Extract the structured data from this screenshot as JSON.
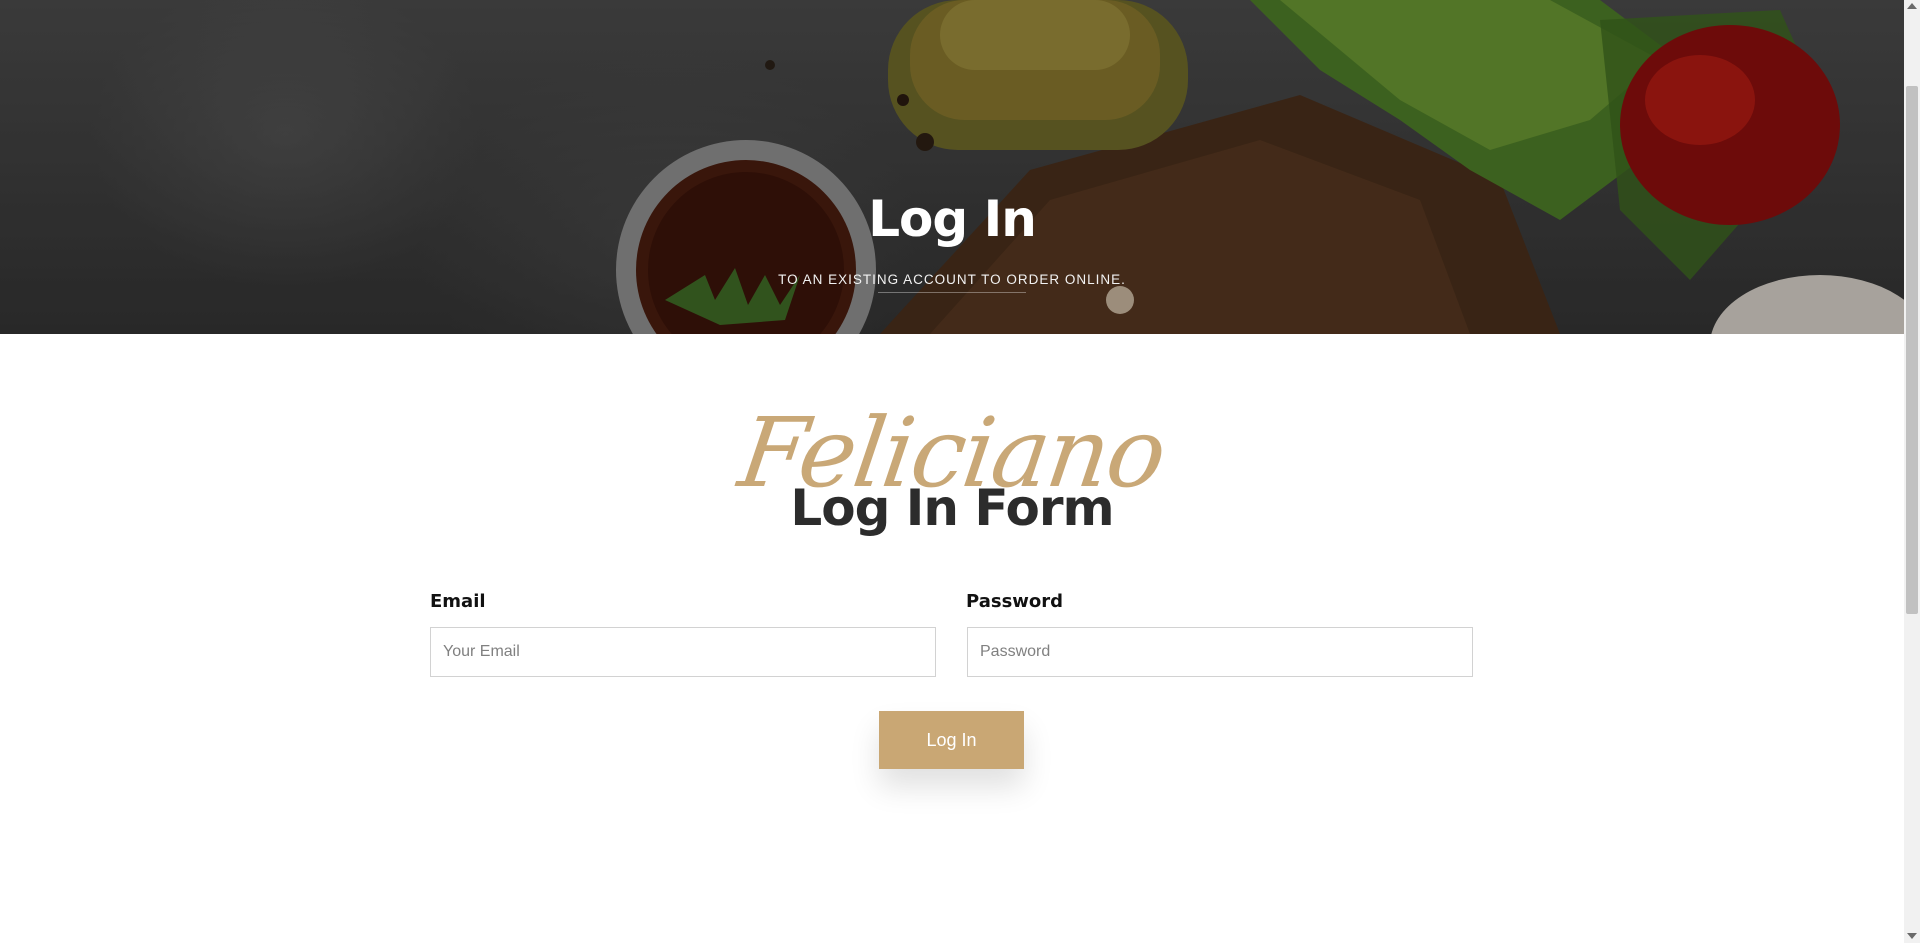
{
  "hero": {
    "title": "Log In",
    "subtitle": "TO AN EXISTING ACCOUNT TO ORDER ONLINE."
  },
  "section": {
    "script_word": "Feliciano",
    "title": "Log In Form"
  },
  "form": {
    "email_label": "Email",
    "email_placeholder": "Your Email",
    "password_label": "Password",
    "password_placeholder": "Password",
    "submit_label": "Log In"
  },
  "colors": {
    "accent": "#c9a774",
    "heading": "#2c2c2c"
  },
  "icons": {
    "scroll_up": "scroll-up-arrow-icon",
    "scroll_down": "scroll-down-arrow-icon"
  }
}
